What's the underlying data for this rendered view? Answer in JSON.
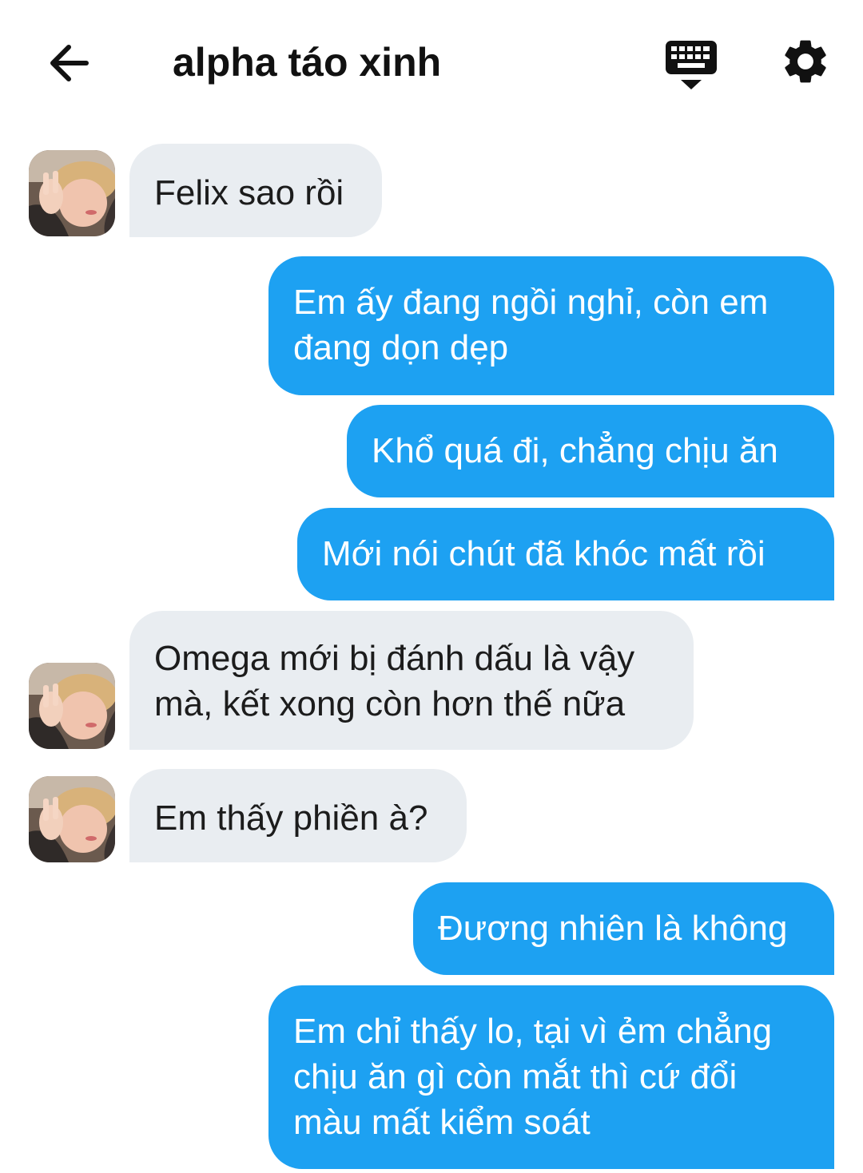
{
  "header": {
    "title": "alpha táo xinh",
    "back_icon": "arrow-left-icon",
    "keyboard_icon": "keyboard-icon",
    "settings_icon": "gear-icon"
  },
  "colors": {
    "incoming_bubble": "#e9edf1",
    "outgoing_bubble": "#1da1f2",
    "outgoing_text": "#ffffff",
    "incoming_text": "#1c1c1c"
  },
  "messages": [
    {
      "side": "in",
      "text": "Felix sao rồi"
    },
    {
      "side": "out",
      "text": "Em ấy đang ngồi nghỉ, còn em đang dọn dẹp"
    },
    {
      "side": "out",
      "text": "Khổ quá đi, chẳng chịu ăn"
    },
    {
      "side": "out",
      "text": "Mới nói chút đã khóc mất rồi"
    },
    {
      "side": "in",
      "text": "Omega mới bị đánh dấu là vậy mà, kết xong còn hơn thế nữa"
    },
    {
      "side": "in",
      "text": "Em thấy phiền à?"
    },
    {
      "side": "out",
      "text": "Đương nhiên là không"
    },
    {
      "side": "out",
      "text": "Em chỉ thấy lo, tại vì ẻm chẳng chịu ăn gì còn mắt thì cứ đổi màu mất kiểm soát"
    }
  ]
}
